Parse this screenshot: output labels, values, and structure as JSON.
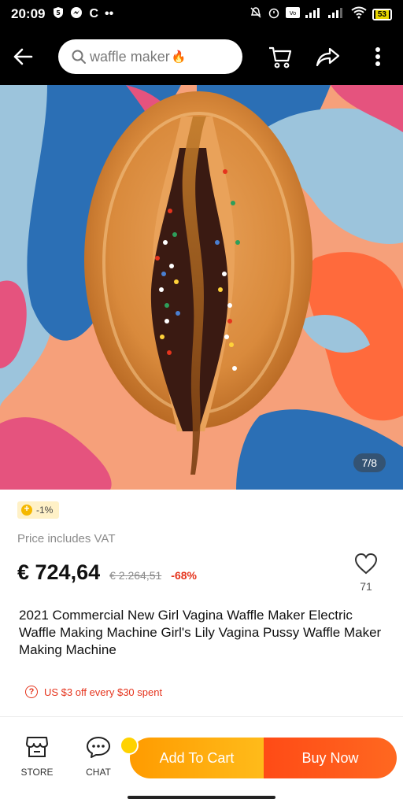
{
  "status_bar": {
    "time": "20:09",
    "notifications": [
      "shield-icon",
      "messenger-icon",
      "C",
      "••"
    ],
    "battery": "53"
  },
  "header": {
    "search_query": "waffle maker",
    "search_emoji": "🔥",
    "icons": [
      "back-arrow-icon",
      "cart-icon",
      "share-icon",
      "more-vertical-icon"
    ]
  },
  "gallery": {
    "counter": "7/8"
  },
  "product": {
    "coins_badge": "-1%",
    "vat_note": "Price includes VAT",
    "price": "€ 724,64",
    "old_price": "€ 2.264,51",
    "discount": "-68%",
    "wishlist_count": "71",
    "title": "2021 Commercial New Girl Vagina Waffle Maker Electric Waffle Making Machine Girl's Lily Vagina Pussy Waffle Maker Making Machine",
    "promo": "US $3 off every $30 spent"
  },
  "bottom_bar": {
    "store_label": "STORE",
    "chat_label": "CHAT",
    "add_to_cart": "Add To Cart",
    "buy_now": "Buy Now"
  },
  "colors": {
    "accent_red": "#e5341d",
    "cart_orange": "#ffa500",
    "buy_orange": "#ff5a1a"
  }
}
